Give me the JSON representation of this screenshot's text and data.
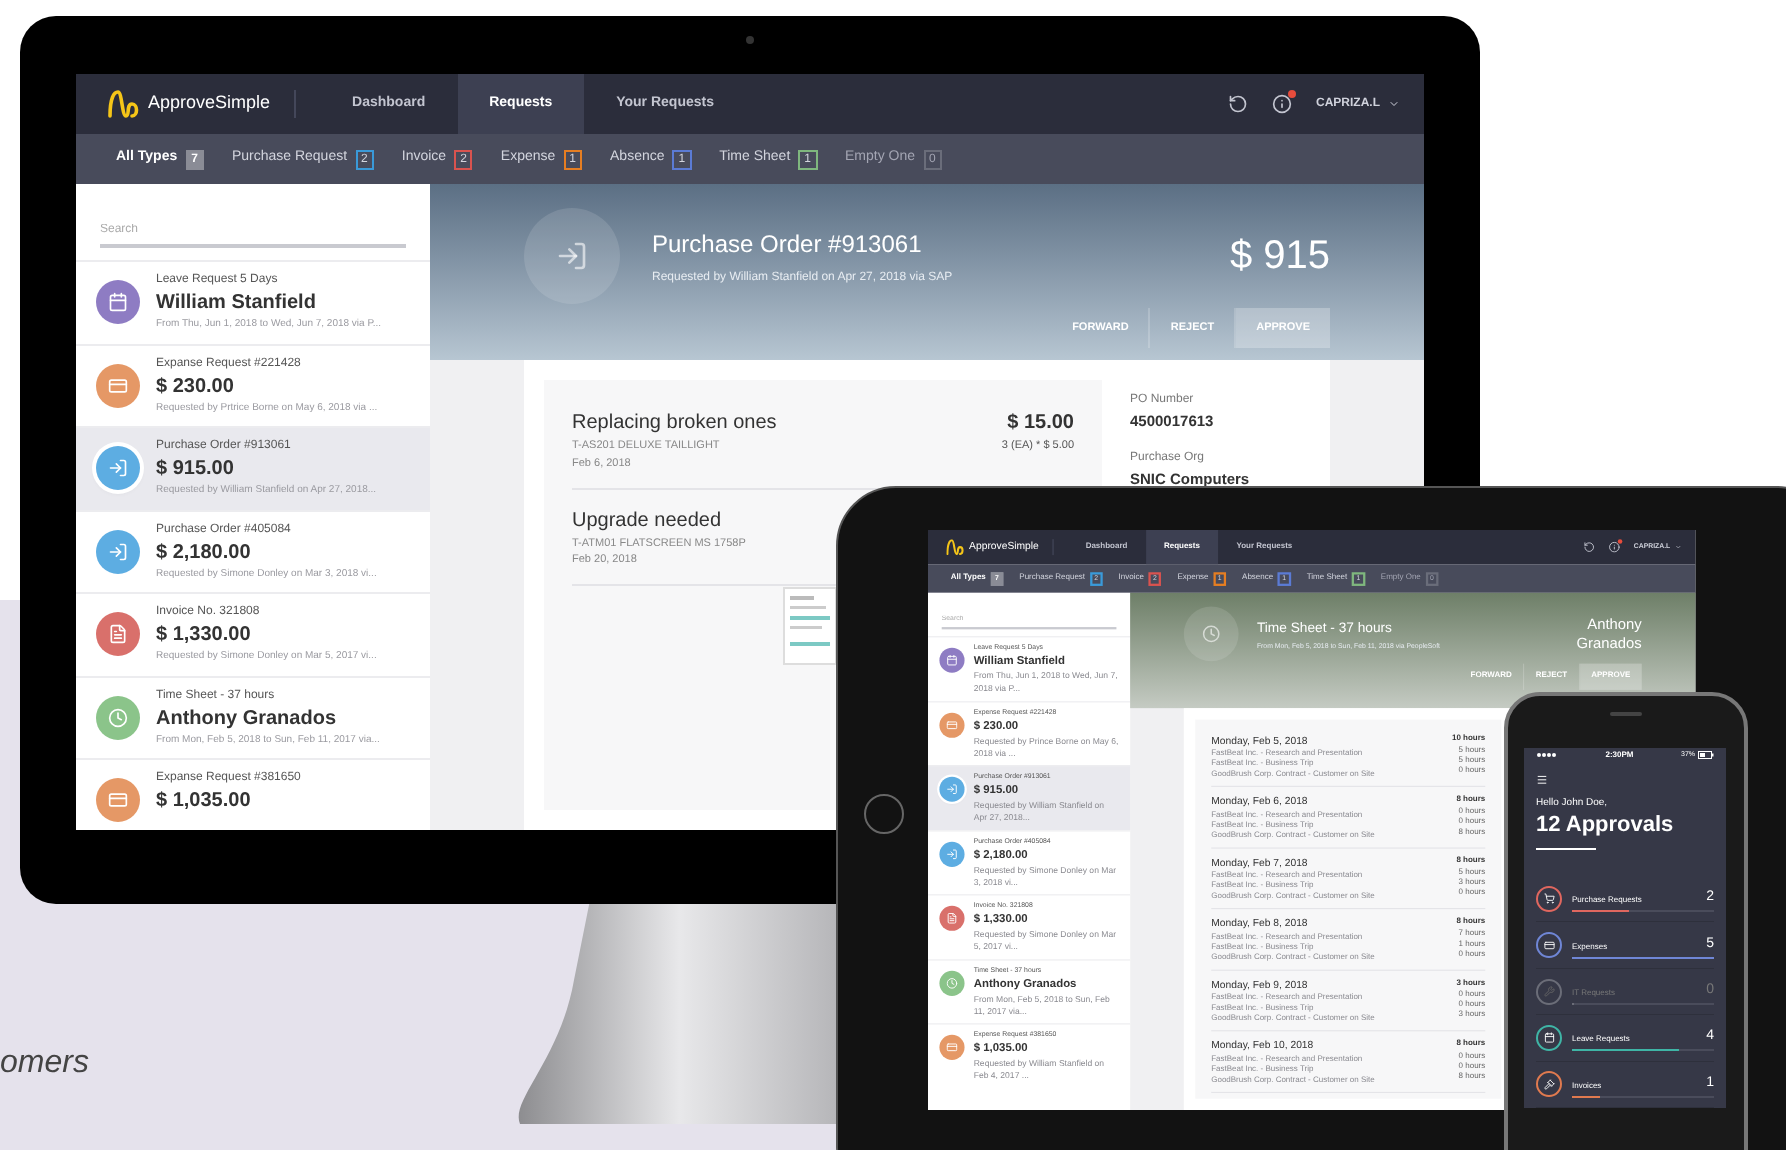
{
  "monitor": {
    "logo": "ApproveSimple",
    "nav": [
      {
        "label": "Dashboard",
        "selected": false
      },
      {
        "label": "Requests",
        "selected": true
      },
      {
        "label": "Your Requests",
        "selected": false
      }
    ],
    "user": "CAPRIZA.L",
    "filters": [
      {
        "label": "All Types",
        "count": "7",
        "color": "#8a8c96",
        "selected": true,
        "disabled": false
      },
      {
        "label": "Purchase Request",
        "count": "2",
        "color": "#3a9ad9",
        "selected": false,
        "disabled": false
      },
      {
        "label": "Invoice",
        "count": "2",
        "color": "#d9534f",
        "selected": false,
        "disabled": false
      },
      {
        "label": "Expense",
        "count": "1",
        "color": "#e67e22",
        "selected": false,
        "disabled": false
      },
      {
        "label": "Absence",
        "count": "1",
        "color": "#5b7bd5",
        "selected": false,
        "disabled": false
      },
      {
        "label": "Time Sheet",
        "count": "1",
        "color": "#7fb77e",
        "selected": false,
        "disabled": false
      },
      {
        "label": "Empty One",
        "count": "0",
        "color": "#6a6d7a",
        "selected": false,
        "disabled": true
      }
    ],
    "search": {
      "placeholder": "Search"
    },
    "requests": [
      {
        "kind": "leave",
        "title": "Leave Request 5 Days",
        "headline": "William Stanfield",
        "subtitle": "From Thu, Jun 1, 2018 to Wed, Jun 7, 2018 via P...",
        "color": "#8e7cc3",
        "selected": false
      },
      {
        "kind": "expense",
        "title": "Expanse Request #221428",
        "headline": "$ 230.00",
        "subtitle": "Requested by Prtrice Borne on May 6, 2018 via ...",
        "color": "#e59866",
        "selected": false
      },
      {
        "kind": "purchase",
        "title": "Purchase Order #913061",
        "headline": "$ 915.00",
        "subtitle": "Requested by William Stanfield on Apr 27, 2018...",
        "color": "#5dade2",
        "selected": true
      },
      {
        "kind": "purchase",
        "title": "Purchase Order #405084",
        "headline": "$ 2,180.00",
        "subtitle": "Requested by Simone Donley on Mar 3, 2018 vi...",
        "color": "#5dade2",
        "selected": false
      },
      {
        "kind": "invoice",
        "title": "Invoice No. 321808",
        "headline": "$ 1,330.00",
        "subtitle": "Requested by Simone Donley on Mar 5, 2017 vi...",
        "color": "#d9706b",
        "selected": false
      },
      {
        "kind": "timesheet",
        "title": "Time Sheet - 37 hours",
        "headline": "Anthony Granados",
        "subtitle": "From Mon, Feb 5, 2018 to Sun, Feb 11, 2017 via...",
        "color": "#8bc48a",
        "selected": false
      },
      {
        "kind": "expense",
        "title": "Expanse Request #381650",
        "headline": "$ 1,035.00",
        "color": "#e59866",
        "selected": false
      }
    ],
    "detail": {
      "kind": "purchase",
      "title": "Purchase Order #913061",
      "subtitle": "Requested by William Stanfield on Apr 27, 2018 via SAP",
      "amount": "$ 915",
      "buttons": [
        {
          "label": "FORWARD",
          "selected": false
        },
        {
          "label": "REJECT",
          "selected": false
        },
        {
          "label": "APPROVE",
          "selected": true
        }
      ],
      "lines": [
        {
          "title": "Replacing broken ones",
          "code": "T-AS201 DELUXE TAILLIGHT",
          "date": "Feb 6, 2018",
          "total": "$ 15.00",
          "quantity": "3 (EA) * $ 5.00"
        },
        {
          "title": "Upgrade needed",
          "code": "T-ATM01 FLATSCREEN MS 1758P",
          "date": "Feb 20, 2018"
        }
      ],
      "info": [
        {
          "label": "PO Number",
          "value": "4500017613"
        },
        {
          "label": "Purchase Org",
          "value": "SNIC Computers"
        }
      ]
    }
  },
  "tablet": {
    "logo": "ApproveSimple",
    "nav": [
      {
        "label": "Dashboard",
        "selected": false
      },
      {
        "label": "Requests",
        "selected": true
      },
      {
        "label": "Your Requests",
        "selected": false
      }
    ],
    "user": "CAPRIZA.L",
    "filters": [
      {
        "label": "All Types",
        "count": "7",
        "color": "#8a8c96",
        "selected": true,
        "disabled": false
      },
      {
        "label": "Purchase Request",
        "count": "2",
        "color": "#3a9ad9",
        "selected": false,
        "disabled": false
      },
      {
        "label": "Invoice",
        "count": "2",
        "color": "#d9534f",
        "selected": false,
        "disabled": false
      },
      {
        "label": "Expense",
        "count": "1",
        "color": "#e67e22",
        "selected": false,
        "disabled": false
      },
      {
        "label": "Absence",
        "count": "1",
        "color": "#5b7bd5",
        "selected": false,
        "disabled": false
      },
      {
        "label": "Time Sheet",
        "count": "1",
        "color": "#7fb77e",
        "selected": false,
        "disabled": false
      },
      {
        "label": "Empty One",
        "count": "0",
        "color": "#6a6d7a",
        "selected": false,
        "disabled": true
      }
    ],
    "search": {
      "placeholder": "Search"
    },
    "requests": [
      {
        "kind": "leave",
        "title": "Leave Request 5 Days",
        "headline": "William Stanfield",
        "subtitle": "From Thu, Jun 1, 2018 to Wed, Jun 7, 2018 via P...",
        "color": "#8e7cc3",
        "selected": false
      },
      {
        "kind": "expense",
        "title": "Expense Request #221428",
        "headline": "$ 230.00",
        "subtitle": "Requested by Prince Borne on May 6, 2018 via ...",
        "color": "#e59866",
        "selected": false
      },
      {
        "kind": "purchase",
        "title": "Purchase Order #913061",
        "headline": "$ 915.00",
        "subtitle": "Requested by William Stanfield on Apr 27, 2018...",
        "color": "#5dade2",
        "selected": true
      },
      {
        "kind": "purchase",
        "title": "Purchase Order #405084",
        "headline": "$ 2,180.00",
        "subtitle": "Requested by Simone Donley on Mar 3, 2018 vi...",
        "color": "#5dade2",
        "selected": false
      },
      {
        "kind": "invoice",
        "title": "Invoice No. 321808",
        "headline": "$ 1,330.00",
        "subtitle": "Requested by Simone Donley on Mar 5, 2017 vi...",
        "color": "#d9706b",
        "selected": false
      },
      {
        "kind": "timesheet",
        "title": "Time Sheet - 37 hours",
        "headline": "Anthony Granados",
        "subtitle": "From Mon, Feb 5, 2018 to Sun, Feb 11, 2017 via...",
        "color": "#8bc48a",
        "selected": false
      },
      {
        "kind": "expense",
        "title": "Expense Request #381650",
        "headline": "$ 1,035.00",
        "subtitle": "Requested by William Stanfield on Feb 4, 2017 ...",
        "color": "#e59866",
        "selected": false
      }
    ],
    "detail": {
      "kind": "timesheet",
      "title": "Time Sheet - 37 hours",
      "subtitle": "From Mon, Feb 5, 2018 to Sun, Feb 11, 2018 via PeopleSoft",
      "amount": "Anthony Granados",
      "buttons": [
        {
          "label": "FORWARD",
          "selected": false
        },
        {
          "label": "REJECT",
          "selected": false
        },
        {
          "label": "APPROVE",
          "selected": true
        }
      ],
      "days": [
        {
          "day": "Monday, Feb 5, 2018",
          "total": "10 hours",
          "entries": [
            {
              "label": "FastBeat Inc. - Research and Presentation",
              "hours": "5 hours"
            },
            {
              "label": "FastBeat Inc. - Business Trip",
              "hours": "5 hours"
            },
            {
              "label": "GoodBrush Corp. Contract - Customer on Site",
              "hours": "0 hours"
            }
          ]
        },
        {
          "day": "Monday, Feb 6, 2018",
          "total": "8 hours",
          "entries": [
            {
              "label": "FastBeat Inc. - Research and Presentation",
              "hours": "0 hours"
            },
            {
              "label": "FastBeat Inc. - Business Trip",
              "hours": "0 hours"
            },
            {
              "label": "GoodBrush Corp. Contract - Customer on Site",
              "hours": "8 hours"
            }
          ]
        },
        {
          "day": "Monday, Feb 7, 2018",
          "total": "8 hours",
          "entries": [
            {
              "label": "FastBeat Inc. - Research and Presentation",
              "hours": "5 hours"
            },
            {
              "label": "FastBeat Inc. - Business Trip",
              "hours": "3 hours"
            },
            {
              "label": "GoodBrush Corp. Contract - Customer on Site",
              "hours": "0 hours"
            }
          ]
        },
        {
          "day": "Monday, Feb 8, 2018",
          "total": "8 hours",
          "entries": [
            {
              "label": "FastBeat Inc. - Research and Presentation",
              "hours": "7 hours"
            },
            {
              "label": "FastBeat Inc. - Business Trip",
              "hours": "1 hours"
            },
            {
              "label": "GoodBrush Corp. Contract - Customer on Site",
              "hours": "0 hours"
            }
          ]
        },
        {
          "day": "Monday, Feb 9, 2018",
          "total": "3 hours",
          "entries": [
            {
              "label": "FastBeat Inc. - Research and Presentation",
              "hours": "0 hours"
            },
            {
              "label": "FastBeat Inc. - Business Trip",
              "hours": "0 hours"
            },
            {
              "label": "GoodBrush Corp. Contract - Customer on Site",
              "hours": "3 hours"
            }
          ]
        },
        {
          "day": "Monday, Feb 10, 2018",
          "total": "8 hours",
          "entries": [
            {
              "label": "FastBeat Inc. - Research and Presentation",
              "hours": "0 hours"
            },
            {
              "label": "FastBeat Inc. - Business Trip",
              "hours": "0 hours"
            },
            {
              "label": "GoodBrush Corp. Contract - Customer on Site",
              "hours": "8 hours"
            }
          ]
        }
      ]
    }
  },
  "phone": {
    "time": "2:30PM",
    "battery": "37%",
    "greeting": "Hello John Doe,",
    "title": "12 Approvals",
    "rows": [
      {
        "kind": "purchase",
        "label": "Purchase Requests",
        "count": "2",
        "color": "#e0675f",
        "level": 0.4,
        "disabled": false
      },
      {
        "kind": "expense",
        "label": "Expenses",
        "count": "5",
        "color": "#6f86d6",
        "level": 1,
        "disabled": false
      },
      {
        "kind": "it",
        "label": "IT Requests",
        "count": "0",
        "color": "#6b6d78",
        "level": 0,
        "disabled": true
      },
      {
        "kind": "leave",
        "label": "Leave Requests",
        "count": "4",
        "color": "#3fb5a6",
        "level": 0.75,
        "disabled": false
      },
      {
        "kind": "invoice",
        "label": "Invoices",
        "count": "1",
        "color": "#e07a4f",
        "level": 0.2,
        "disabled": false
      }
    ]
  },
  "page_text": "omers"
}
